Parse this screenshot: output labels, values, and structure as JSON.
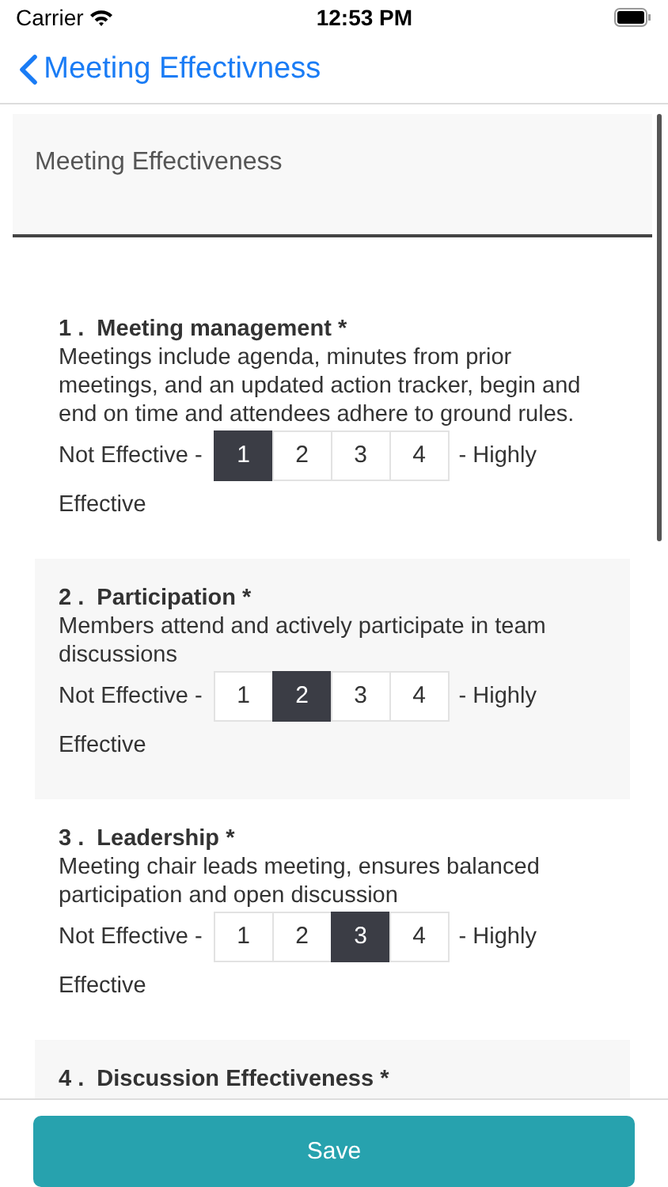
{
  "status_bar": {
    "carrier": "Carrier",
    "time": "12:53 PM"
  },
  "nav": {
    "back_label": "Meeting Effectivness"
  },
  "form_title": "Meeting Effectiveness",
  "questions": [
    {
      "number": "1 .",
      "title": "Meeting management *",
      "description": "Meetings include agenda, minutes from prior meetings, and an updated action tracker, begin and end on time and attendees adhere to ground rules.",
      "low_label": "Not Effective -",
      "high_label": "- Highly",
      "high_label_wrap": "Effective",
      "options": [
        {
          "label": "1",
          "selected": true
        },
        {
          "label": "2",
          "selected": false
        },
        {
          "label": "3",
          "selected": false
        },
        {
          "label": "4",
          "selected": false
        }
      ]
    },
    {
      "number": "2 .",
      "title": "Participation *",
      "description": "Members attend and actively participate in team discussions",
      "low_label": "Not Effective -",
      "high_label": "- Highly",
      "high_label_wrap": "Effective",
      "options": [
        {
          "label": "1",
          "selected": false
        },
        {
          "label": "2",
          "selected": true
        },
        {
          "label": "3",
          "selected": false
        },
        {
          "label": "4",
          "selected": false
        }
      ]
    },
    {
      "number": "3 .",
      "title": "Leadership *",
      "description": "Meeting chair leads meeting, ensures balanced participation and open discussion",
      "low_label": "Not Effective -",
      "high_label": "- Highly",
      "high_label_wrap": "Effective",
      "options": [
        {
          "label": "1",
          "selected": false
        },
        {
          "label": "2",
          "selected": false
        },
        {
          "label": "3",
          "selected": true
        },
        {
          "label": "4",
          "selected": false
        }
      ]
    },
    {
      "number": "4 .",
      "title": "Discussion Effectiveness *"
    }
  ],
  "save_button": "Save"
}
